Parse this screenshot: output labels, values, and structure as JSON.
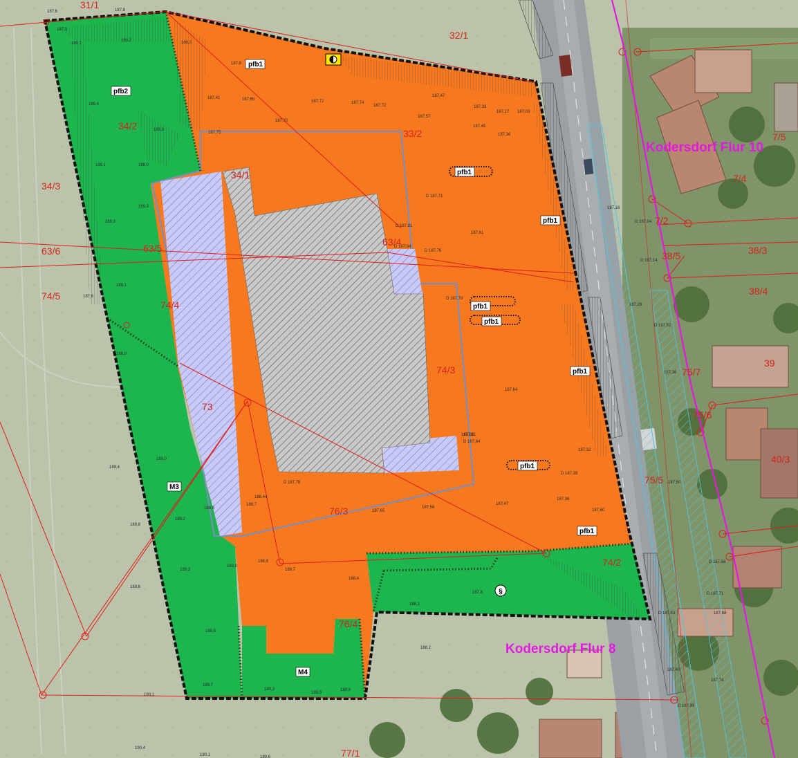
{
  "parcels": [
    "31/1",
    "32/1",
    "34/2",
    "34/3",
    "34/1",
    "33/2",
    "63/5",
    "63/6",
    "63/4",
    "74/5",
    "74/4",
    "74/3",
    "73",
    "76/3",
    "76/4",
    "74/2",
    "7/5",
    "7/4",
    "7/2",
    "38/5",
    "38/3",
    "38/4",
    "39",
    "75/7",
    "75/6",
    "40/3",
    "75/5",
    "77/1"
  ],
  "zones": [
    "pfb1",
    "pfb2",
    "M3",
    "M4"
  ],
  "flur_labels": [
    "Kodersdorf Flur 10",
    "Kodersdorf Flur 8"
  ],
  "elevations": [
    "187,6",
    "187,8",
    "187,9",
    "189,2",
    "189,1",
    "188,3",
    "187,8",
    "187,41",
    "187,65",
    "187,72",
    "187,74",
    "187,72",
    "187,47",
    "187,33",
    "187,27",
    "187,03",
    "187,70",
    "187,57",
    "187,45",
    "187,36",
    "187,75",
    "189,3",
    "189,4",
    "189,1",
    "189,0",
    "189,3",
    "D 187,71",
    "D 187,81",
    "D 187,84",
    "187,61",
    "D 187,76",
    "D 187,78",
    "187,64",
    "D 187,64",
    "187,81",
    "187,32",
    "D 187,39",
    "187,47",
    "187,36",
    "187,60",
    "187,56",
    "187,65",
    "D 187,78",
    "188,44",
    "188,7",
    "188,6",
    "188,4",
    "188,7",
    "189,0",
    "188,8",
    "188,1",
    "187,8",
    "188,2",
    "189,3",
    "189,0",
    "188,6",
    "189,7",
    "189,5",
    "189,3",
    "189,2",
    "189,0",
    "189,8",
    "189,4",
    "189,3",
    "189,1",
    "188,9",
    "189,6",
    "190,1",
    "190,4",
    "190,1",
    "189,6",
    "187,16",
    "D 187,04",
    "D 187,14",
    "187,29",
    "D 187,52",
    "187,38",
    "187,50",
    "D 187,56",
    "D 187,71",
    "187,68",
    "187,74",
    "D 187,63",
    "187,40",
    "D 187,89",
    "187,81",
    "187,6"
  ],
  "colors": {
    "industrial": "#f7791f",
    "green": "#19b84d",
    "building_hatch": "#8a8a8a",
    "parking_hatch": "#bcbdf2",
    "parcel_line": "#e01c1c",
    "flur_line": "#e21adf",
    "waterway_hatch": "#5ad1e8",
    "boundary": "#111111"
  }
}
